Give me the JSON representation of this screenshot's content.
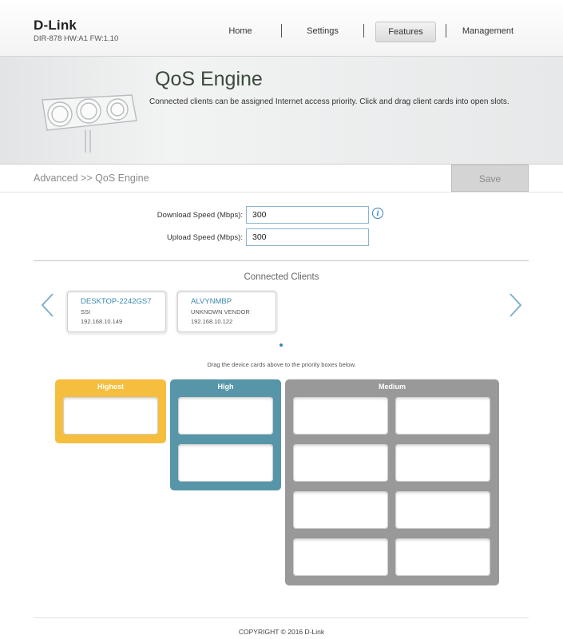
{
  "header": {
    "brand": "D-Link",
    "model_info": "DIR-878 HW:A1 FW:1.10",
    "nav": [
      {
        "label": "Home"
      },
      {
        "label": "Settings"
      },
      {
        "label": "Features",
        "active": true
      },
      {
        "label": "Management"
      }
    ]
  },
  "banner": {
    "title": "QoS Engine",
    "description": "Connected clients can be assigned Internet access priority. Click and drag client cards into open slots."
  },
  "breadcrumb": "Advanced >> QoS Engine",
  "save_label": "Save",
  "speed": {
    "download_label": "Download Speed (Mbps):",
    "download_value": "300",
    "upload_label": "Upload Speed (Mbps):",
    "upload_value": "300"
  },
  "clients": {
    "title": "Connected Clients",
    "items": [
      {
        "name": "DESKTOP-2242GS7",
        "vendor": "SSI",
        "ip": "192.168.10.149"
      },
      {
        "name": "ALVYNMBP",
        "vendor": "UNKNOWN VENDOR",
        "ip": "192.168.10.122"
      }
    ],
    "hint": "Drag the device cards above to the priority boxes below."
  },
  "priorities": {
    "highest": {
      "label": "Highest",
      "color": "#f5be3e",
      "slots": 1
    },
    "high": {
      "label": "High",
      "color": "#5796a8",
      "slots": 2
    },
    "medium": {
      "label": "Medium",
      "color": "#999999",
      "slots": 8
    }
  },
  "footer": {
    "copyright": "COPYRIGHT © 2016 D-Link"
  },
  "colors": {
    "accent": "#3a8ab0",
    "info": "#3b7fc4"
  }
}
